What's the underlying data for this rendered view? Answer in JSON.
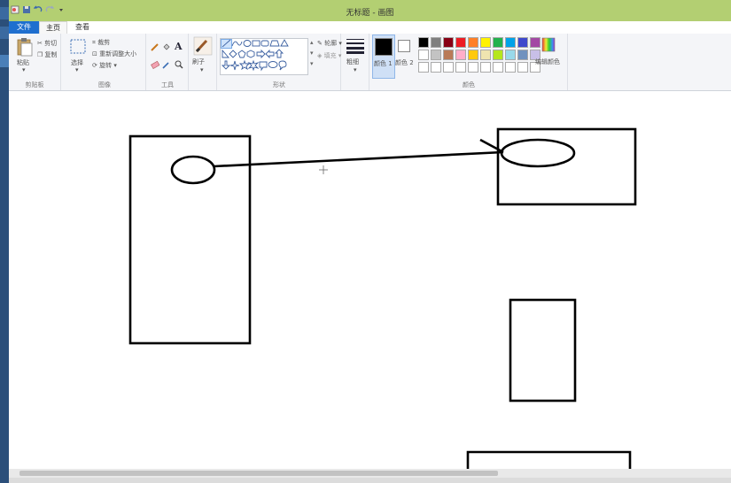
{
  "window": {
    "title": "无标题 - 画图"
  },
  "tabs": [
    {
      "label": "文件"
    },
    {
      "label": "主页"
    },
    {
      "label": "查看"
    }
  ],
  "ribbon": {
    "clipboard": {
      "paste_label": "粘贴",
      "cut_label": "剪切",
      "copy_label": "复制",
      "group_label": "剪贴板"
    },
    "image": {
      "select_label": "选择",
      "crop_label": "裁剪",
      "resize_label": "重新调整大小",
      "rotate_label": "旋转",
      "group_label": "图像"
    },
    "tools": {
      "group_label": "工具"
    },
    "brushes": {
      "label": "刷子"
    },
    "shapes": {
      "outline_label": "轮廓",
      "fill_label": "填充",
      "group_label": "形状"
    },
    "size": {
      "label": "粗细"
    },
    "colors": {
      "color1_label": "颜色 1",
      "color2_label": "颜色 2",
      "edit_label": "编辑颜色",
      "group_label": "颜色",
      "color1": "#000000",
      "color2": "#ffffff",
      "palette": [
        "#000000",
        "#7f7f7f",
        "#880015",
        "#ed1c24",
        "#ff7f27",
        "#fff200",
        "#22b14c",
        "#00a2e8",
        "#3f48cc",
        "#a349a4",
        "#ffffff",
        "#c3c3c3",
        "#b97a57",
        "#ffaec9",
        "#ffc90e",
        "#efe4b0",
        "#b5e61d",
        "#99d9ea",
        "#7092be",
        "#c8bfe7",
        "#ffffff",
        "#ffffff",
        "#ffffff",
        "#ffffff",
        "#ffffff",
        "#ffffff",
        "#ffffff",
        "#ffffff",
        "#ffffff",
        "#ffffff"
      ]
    }
  },
  "canvas": {
    "background": "#ffffff",
    "stroke": "#000000"
  }
}
